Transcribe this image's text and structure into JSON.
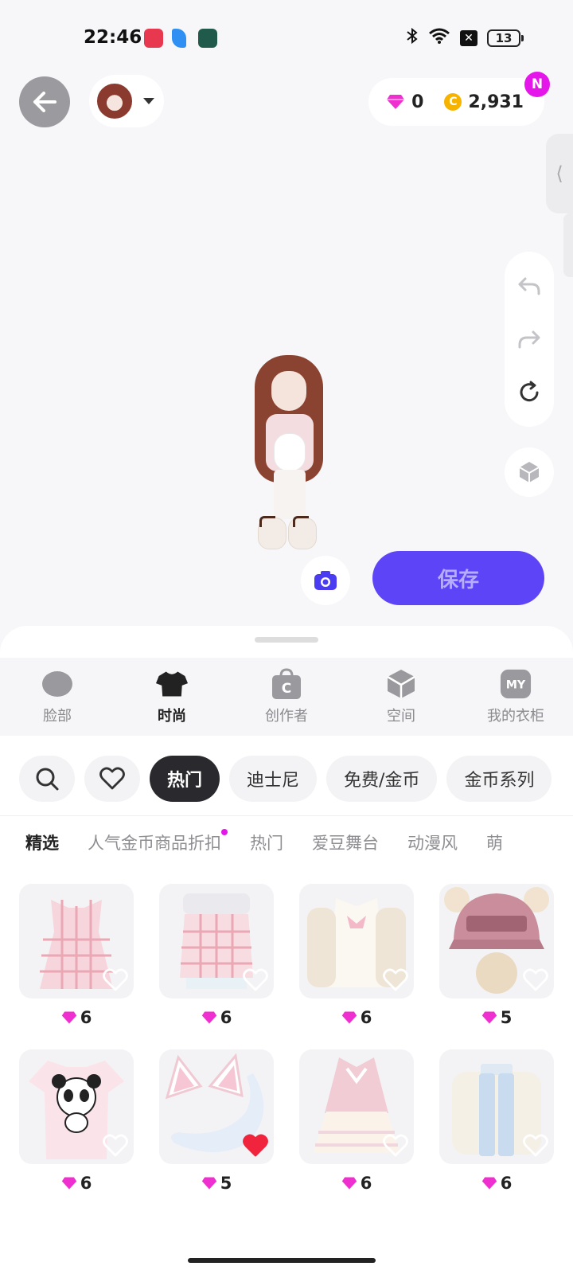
{
  "status_bar": {
    "time": "22:46",
    "battery": "13",
    "icons": [
      "video-app-icon",
      "feather-app-icon",
      "robot-app-icon",
      "bluetooth-icon",
      "wifi-icon",
      "sim-off-icon",
      "battery-icon"
    ]
  },
  "header": {
    "diamonds": "0",
    "coins": "2,931",
    "coin_symbol": "C",
    "new_badge": "N"
  },
  "toolbar": {
    "save_label": "保存"
  },
  "categories": [
    {
      "label": "脸部",
      "icon": "face-icon"
    },
    {
      "label": "时尚",
      "icon": "tshirt-icon"
    },
    {
      "label": "创作者",
      "icon": "creator-bag-icon",
      "glyph": "C"
    },
    {
      "label": "空间",
      "icon": "cube-icon"
    },
    {
      "label": "我的衣柜",
      "icon": "my-wardrobe-icon",
      "glyph": "MY"
    }
  ],
  "filters": [
    "热门",
    "迪士尼",
    "免费/金币",
    "金币系列"
  ],
  "subtabs": [
    "精选",
    "人气金币商品折扣",
    "热门",
    "爱豆舞台",
    "动漫风",
    "萌"
  ],
  "items": [
    {
      "price": "6",
      "name": "pink-plaid-dress",
      "liked": false
    },
    {
      "price": "6",
      "name": "pink-plaid-top",
      "liked": false
    },
    {
      "price": "6",
      "name": "cream-cardigan-set",
      "liked": false
    },
    {
      "price": "5",
      "name": "pink-pompom-cap",
      "liked": false
    },
    {
      "price": "6",
      "name": "panda-tshirt",
      "liked": false
    },
    {
      "price": "5",
      "name": "cat-ears-and-tail",
      "liked": true
    },
    {
      "price": "6",
      "name": "pink-jacket-skirt",
      "liked": false
    },
    {
      "price": "6",
      "name": "cardigan-blue-pants",
      "liked": false
    }
  ],
  "colors": {
    "accent": "#5d45f7",
    "gem": "#f02fd0",
    "coin": "#f6b400",
    "liked_heart": "#f0243d"
  }
}
